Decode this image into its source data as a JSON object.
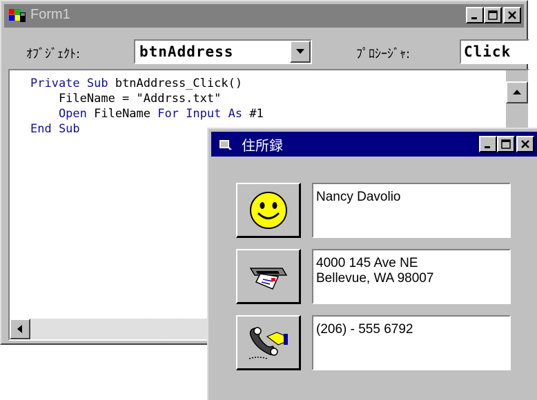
{
  "form1": {
    "title": "Form1",
    "object_label": "ｵﾌﾞｼﾞｪｸﾄ:",
    "object_value": "btnAddress",
    "procedure_label": "ﾌﾟﾛｼｰｼﾞｬ:",
    "procedure_value": "Click",
    "code": {
      "line1_kw1": "Private Sub",
      "line1_rest": " btnAddress_Click()",
      "line2": "    FileName = \"Addrss.txt\"",
      "line3_kw1": "    Open",
      "line3_mid": " FileName ",
      "line3_kw2": "For Input As",
      "line3_rest": " #1",
      "line4_kw": "End Sub"
    }
  },
  "address_window": {
    "title": "住所録",
    "name": "Nancy Davolio",
    "address_line1": "4000 145 Ave NE",
    "address_line2": "Bellevue, WA  98007",
    "phone": "(206) - 555 6792"
  },
  "colors": {
    "active_title": "#000080",
    "inactive_title": "#808080",
    "face": "#c0c0c0",
    "keyword": "#1010a0"
  },
  "icons": {
    "form1": "vb-form-icon",
    "address": "address-book-icon",
    "name_button": "smiley-face-icon",
    "address_button": "mail-slot-icon",
    "phone_button": "telephone-icon"
  }
}
